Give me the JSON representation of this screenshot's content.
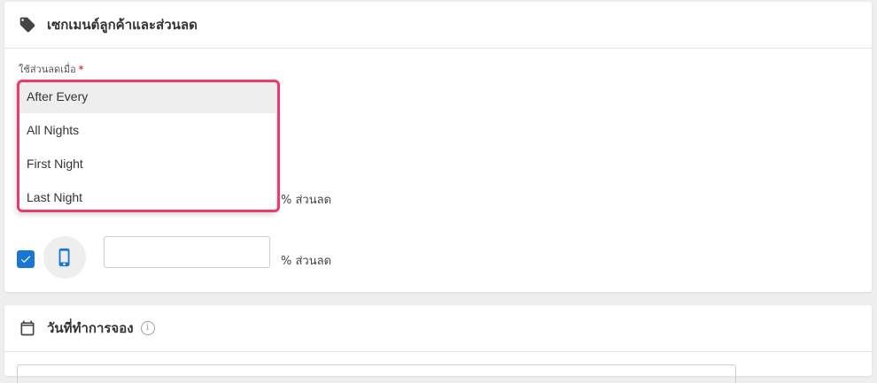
{
  "section1": {
    "title": "เซกเมนต์ลูกค้าและส่วนลด",
    "field_label": "ใช้ส่วนลดเมื่อ",
    "required_mark": "*",
    "dropdown": {
      "options": [
        "After Every",
        "All Nights",
        "First Night",
        "Last Night"
      ],
      "highlighted": "After Every"
    },
    "row1_suffix": "% ส่วนลด",
    "row2": {
      "checked": true,
      "device_icon": "mobile-phone-icon",
      "input_value": "",
      "suffix": "% ส่วนลด"
    }
  },
  "section2": {
    "title": "วันที่ทำการจอง",
    "info_icon_glyph": "i"
  },
  "colors": {
    "accent": "#1976d2",
    "highlight_border": "#ee3a6a",
    "required": "#e53935"
  }
}
